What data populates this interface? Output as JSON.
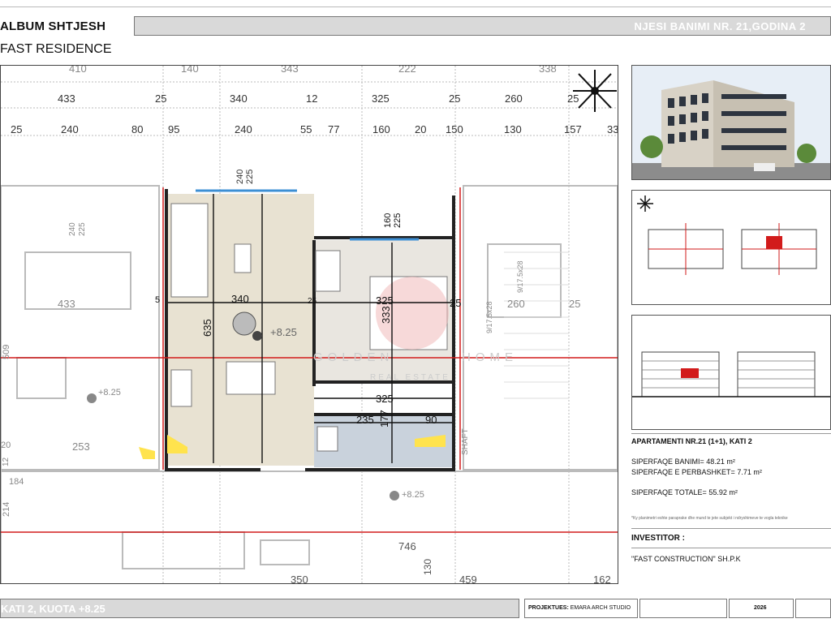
{
  "header": {
    "album_title": "ALBUM SHTJESH",
    "residence": "FAST RESIDENCE",
    "unit_label": "NJESI BANIMI NR. 21,GODINA 2"
  },
  "plan": {
    "dims_top_row1": [
      "410",
      "140",
      "343",
      "222",
      "338"
    ],
    "dims_top_row2": [
      "433",
      "25",
      "340",
      "12",
      "325",
      "25",
      "260",
      "25"
    ],
    "dims_top_row3": [
      "25",
      "240",
      "80",
      "95",
      "240",
      "55",
      "77",
      "160",
      "20",
      "150",
      "130",
      "157",
      "33"
    ],
    "dim_240": "240",
    "dim_225": "225",
    "dim_160": "160",
    "dim_225b": "225",
    "dim_340": "340",
    "dim_325": "325",
    "dim_25a": "25",
    "dim_25b": "25",
    "dim_635": "635",
    "dim_333": "333",
    "dim_level": "+8.25",
    "dim_325b": "325",
    "dim_235": "235",
    "dim_177": "177",
    "dim_90": "90",
    "dim_433": "433",
    "dim_260": "260",
    "dim_25c": "25",
    "dim_509": "509",
    "dim_level2": "+8.25",
    "dim_253": "253",
    "dim_20": "20",
    "dim_12": "12",
    "dim_184": "184",
    "dim_214": "214",
    "dim_240b": "240",
    "dim_225c": "225",
    "dim_level3": "+8.25",
    "dim_746": "746",
    "dim_130": "130",
    "dim_350": "350",
    "dim_459": "459",
    "dim_162": "162",
    "dim_5": "5",
    "shaft": "SHAFT",
    "stairs_a": "9/17.5x28",
    "stairs_b": "9/17.5x28",
    "watermark_a": "GOLDEN",
    "watermark_b": "HOME",
    "watermark_c": "REAL ESTATE"
  },
  "info": {
    "apartment": "APARTAMENTI NR.21 (1+1), KATI 2",
    "net_label": "SIPERFAQE BANIMI=",
    "net_value": "48.21 m²",
    "common_label": "SIPERFAQE E PERBASHKET=",
    "common_value": "7.71 m²",
    "total_label": "SIPERFAQE TOTALE=",
    "total_value": "55.92 m²",
    "note": "*Ky planimetri eshte paraprake dhe mund te jete subjekt i ndryshimeve te vogla teknike",
    "investor_heading": "INVESTITOR :",
    "investor_name": "\"FAST CONSTRUCTION\" SH.P.K"
  },
  "footer": {
    "level": "KATI 2, KUOTA +8.25",
    "project_label": "PROJEKTUES:",
    "project_value": "EMARA ARCH STUDIO",
    "year": "2026"
  },
  "colors": {
    "header_bar": "#d9d9d9",
    "apartment_floor": "#e8e2d2",
    "bath_floor": "#c9d2dc",
    "red_line": "#d21b1b",
    "window_blue": "#3d8fd4",
    "highlight_yellow": "#ffe34d"
  }
}
